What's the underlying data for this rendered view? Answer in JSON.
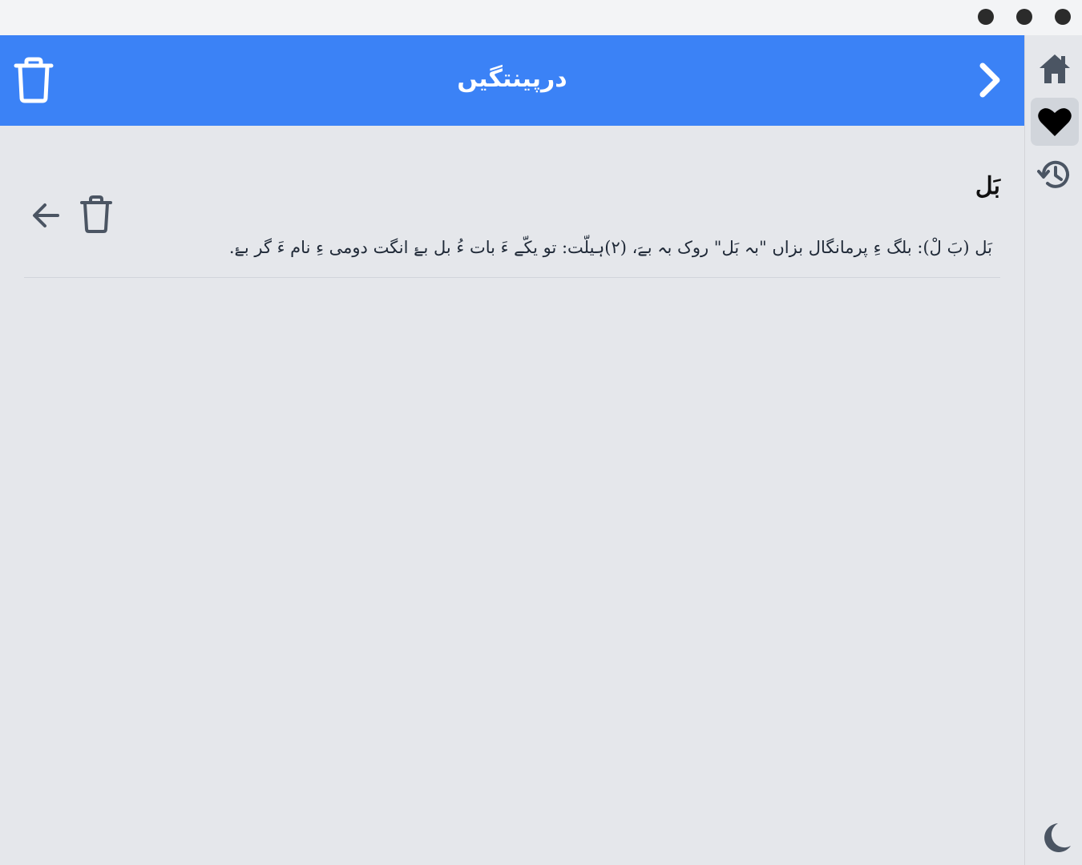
{
  "window": {
    "controls": [
      "minimize",
      "maximize",
      "close"
    ]
  },
  "header": {
    "title": "درپینتگیں",
    "left_icon": "trash-icon",
    "right_icon": "chevron-right-icon",
    "background": "#3b82f6"
  },
  "entry": {
    "word": "بَل",
    "definition": "بَل (بَ لْ): بلگ ءِ پرمانگال بزاں \"بہ بَل\" روک بہ بےَ، (۲)ہیلّت: تو یکّے ءَ بات ءُ بل بۓ انگت دومی ءِ نام ءَ گر بۓ.",
    "actions": [
      "arrow-left-icon",
      "trash-icon"
    ]
  },
  "sidebar": {
    "items": [
      {
        "icon": "home-icon",
        "active": false
      },
      {
        "icon": "heart-icon",
        "active": true
      },
      {
        "icon": "history-icon",
        "active": false
      }
    ],
    "bottom_icon": "moon-icon"
  },
  "colors": {
    "accent": "#3b82f6",
    "background": "#e5e7eb",
    "icon_gray": "#4b5563"
  }
}
